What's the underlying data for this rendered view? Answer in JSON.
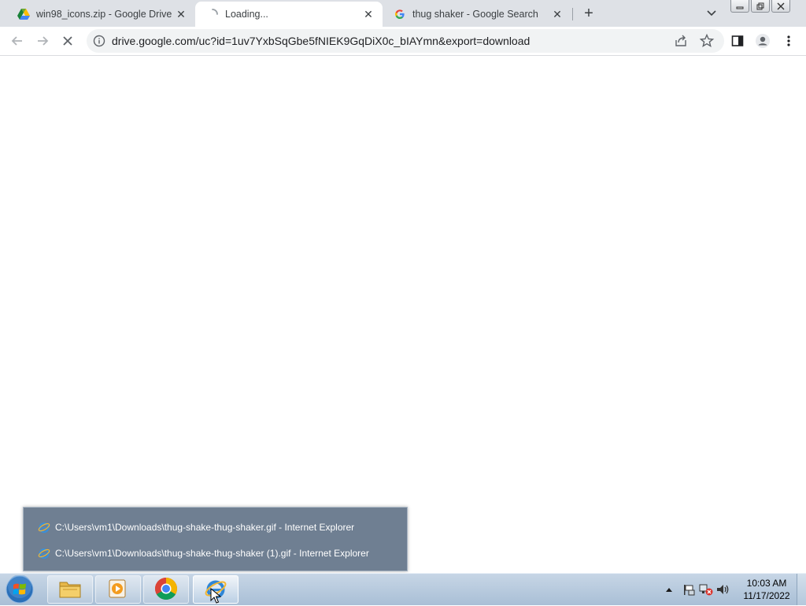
{
  "browser": {
    "tabs": [
      {
        "title": "win98_icons.zip - Google Drive",
        "favicon": "google-drive-icon",
        "active": false
      },
      {
        "title": "Loading...",
        "favicon": "loading-spinner-icon",
        "active": true
      },
      {
        "title": "thug shaker - Google Search",
        "favicon": "google-g-icon",
        "active": false
      }
    ],
    "url": "drive.google.com/uc?id=1uv7YxbSqGbe5fNIEK9GqDiX0c_bIAYmn&export=download"
  },
  "jumplist": {
    "items": [
      {
        "label": "C:\\Users\\vm1\\Downloads\\thug-shake-thug-shaker.gif - Internet Explorer"
      },
      {
        "label": "C:\\Users\\vm1\\Downloads\\thug-shake-thug-shaker (1).gif - Internet Explorer"
      }
    ]
  },
  "taskbar": {
    "time": "10:03 AM",
    "date": "11/17/2022"
  },
  "colors": {
    "tabstrip": "#dee1e6",
    "omnibox": "#f1f3f4",
    "taskbar": "#b8cbe0",
    "jumplist": "#6f7f92"
  }
}
